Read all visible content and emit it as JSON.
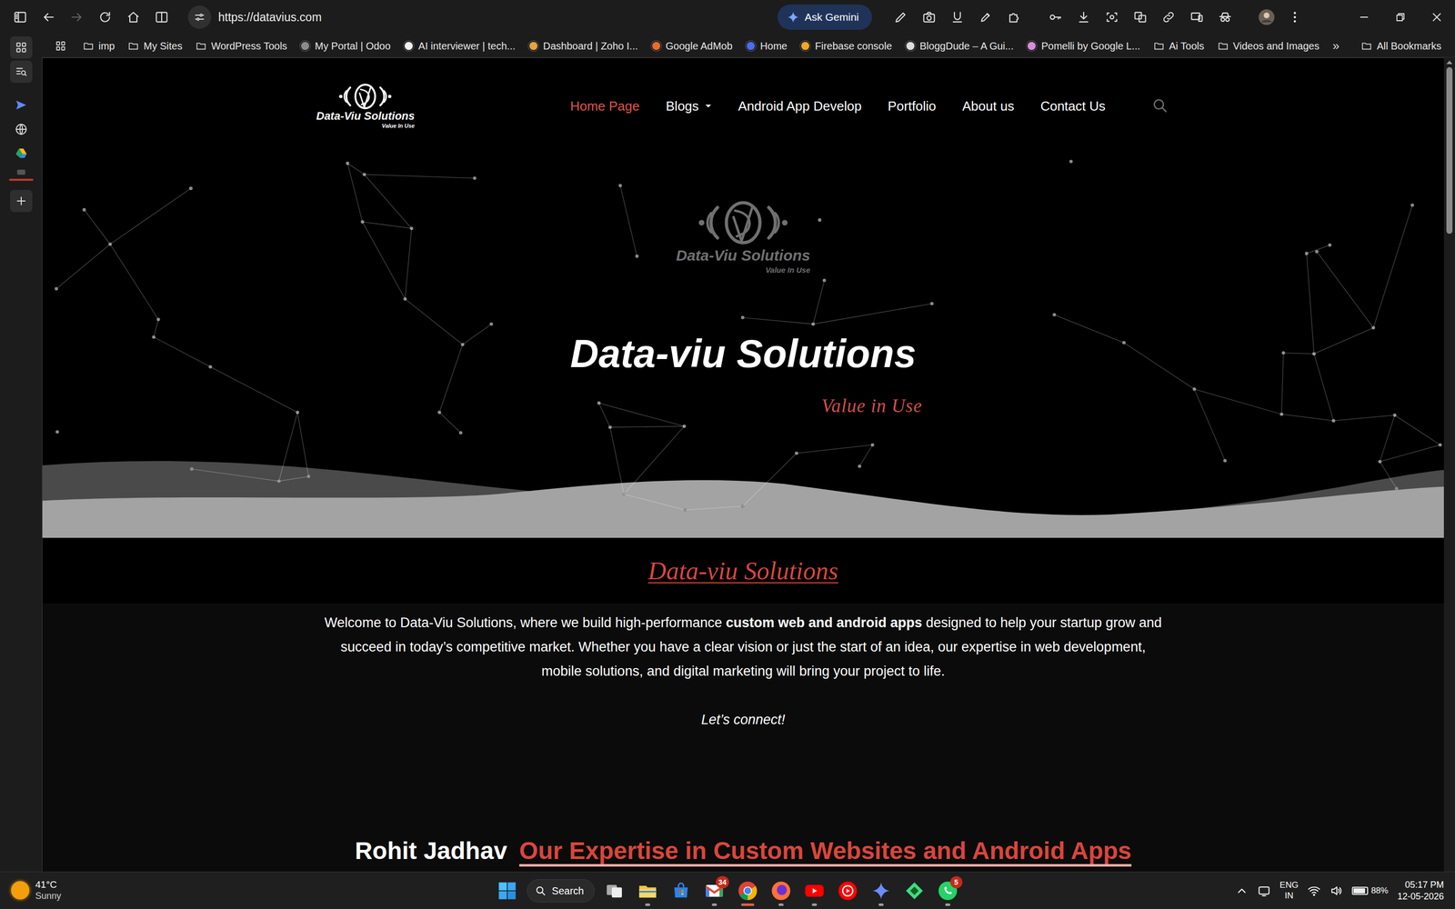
{
  "browser": {
    "nav": {
      "back_enabled": true,
      "forward_enabled": false
    },
    "url": "https://datavius.com",
    "gemini_button": "Ask Gemini",
    "bookmarks": [
      {
        "label": "imp",
        "kind": "folder"
      },
      {
        "label": "My Sites",
        "kind": "folder"
      },
      {
        "label": "WordPress Tools",
        "kind": "folder"
      },
      {
        "label": "My Portal | Odoo",
        "kind": "site",
        "color": "#8b8b8b"
      },
      {
        "label": "AI interviewer | tech...",
        "kind": "site",
        "color": "#f2f2f2"
      },
      {
        "label": "Dashboard | Zoho I...",
        "kind": "site",
        "color": "#e8a33d"
      },
      {
        "label": "Google AdMob",
        "kind": "site",
        "color": "#ea6a2d"
      },
      {
        "label": "Home",
        "kind": "site",
        "color": "#4a6cf7"
      },
      {
        "label": "Firebase console",
        "kind": "site",
        "color": "#f5a623"
      },
      {
        "label": "BloggDude – A Gui...",
        "kind": "site",
        "color": "#dcdcdc"
      },
      {
        "label": "Pomelli by Google L...",
        "kind": "site",
        "color": "#d98be0"
      },
      {
        "label": "Ai Tools",
        "kind": "folder"
      },
      {
        "label": "Videos and Images",
        "kind": "folder"
      }
    ],
    "overflow": "»",
    "all_bookmarks": "All Bookmarks"
  },
  "site": {
    "logo": {
      "name": "Data-Viu Solutions",
      "tagline": "Value In Use"
    },
    "menu": [
      {
        "label": "Home Page",
        "selected": true,
        "dropdown": false
      },
      {
        "label": "Blogs",
        "selected": false,
        "dropdown": true
      },
      {
        "label": "Android App Develop",
        "selected": false,
        "dropdown": false
      },
      {
        "label": "Portfolio",
        "selected": false,
        "dropdown": false
      },
      {
        "label": "About us",
        "selected": false,
        "dropdown": false
      },
      {
        "label": "Contact Us",
        "selected": false,
        "dropdown": false
      }
    ],
    "hero": {
      "logo": {
        "name": "Data-Viu Solutions",
        "tagline": "Value In Use"
      },
      "title": "Data-viu Solutions",
      "tagline": "Value in Use"
    },
    "intro": {
      "heading": "Data-viu Solutions",
      "paragraph": [
        {
          "text": "Welcome to Data-Viu Solutions, where we build high-performance ",
          "bold": false
        },
        {
          "text": "custom web and android apps",
          "bold": true
        },
        {
          "text": " designed to help your startup grow and succeed in today’s competitive market. Whether you have a clear vision or just the start of an idea, our expertise in web development, mobile solutions, and digital marketing will bring your project to life.",
          "bold": false
        }
      ],
      "cta": "Let’s connect!"
    },
    "expertise": {
      "author": "Rohit Jadhav",
      "heading": "Our Expertise in Custom Websites and Android Apps"
    }
  },
  "taskbar": {
    "weather": {
      "temp": "41°C",
      "condition": "Sunny"
    },
    "search": "Search",
    "apps": [
      {
        "open": false,
        "active": false
      },
      {
        "open": true,
        "active": false
      },
      {
        "open": false,
        "active": false
      },
      {
        "open": true,
        "active": false,
        "badge": "34"
      },
      {
        "open": true,
        "active": true
      },
      {
        "open": true,
        "active": false
      },
      {
        "open": true,
        "active": false
      },
      {
        "open": false,
        "active": false
      },
      {
        "open": true,
        "active": false
      },
      {
        "open": false,
        "active": false
      },
      {
        "open": true,
        "active": false,
        "badge": "5"
      }
    ],
    "tray": {
      "lang": "ENG",
      "region": "IN",
      "battery": "88%",
      "battery_level": 0.88,
      "time": "05:17 PM",
      "date": "12-05-2026"
    }
  }
}
